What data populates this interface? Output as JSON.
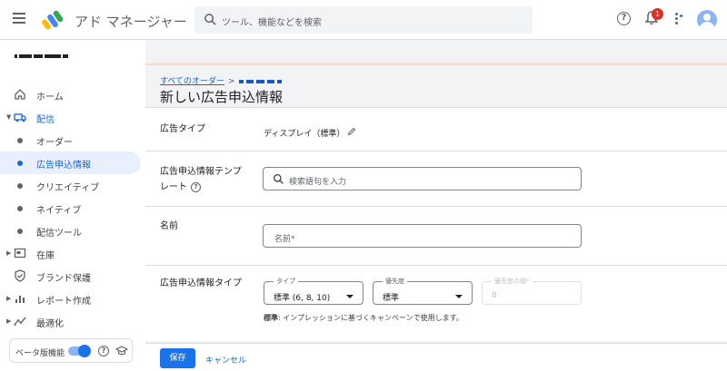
{
  "app": {
    "title": "アド マネージャー"
  },
  "search": {
    "placeholder": "ツール、機能などを検索"
  },
  "notifications": {
    "count": "1"
  },
  "sidebar": {
    "items": [
      {
        "label": "ホーム"
      },
      {
        "label": "配信"
      },
      {
        "label": "オーダー"
      },
      {
        "label": "広告申込情報"
      },
      {
        "label": "クリエイティブ"
      },
      {
        "label": "ネイティブ"
      },
      {
        "label": "配信ツール"
      },
      {
        "label": "在庫"
      },
      {
        "label": "ブランド保護"
      },
      {
        "label": "レポート作成"
      },
      {
        "label": "最適化"
      }
    ],
    "beta_label": "ベータ版機能"
  },
  "breadcrumb": {
    "parent": "すべてのオーダー",
    "separator": ">"
  },
  "page": {
    "title": "新しい広告申込情報"
  },
  "form": {
    "ad_type": {
      "label": "広告タイプ",
      "value": "ディスプレイ（標準）"
    },
    "template": {
      "label": "広告申込情報テンプレート",
      "placeholder": "検索語句を入力"
    },
    "name": {
      "label": "名前",
      "placeholder": "名前*"
    },
    "line_item_type": {
      "label": "広告申込情報タイプ",
      "type_legend": "タイプ",
      "type_value": "標準 (6, 8, 10)",
      "priority_legend": "優先度",
      "priority_value": "標準",
      "priority_value_legend": "優先度の値*",
      "priority_value_value": "8",
      "helper_bold": "標準",
      "helper_text": ": インプレッションに基づくキャンペーンで使用します。"
    }
  },
  "actions": {
    "save": "保存",
    "cancel": "キャンセル"
  },
  "colors": {
    "primary": "#1a73e8",
    "active_bg": "#e8f0fe",
    "badge": "#d93025"
  }
}
